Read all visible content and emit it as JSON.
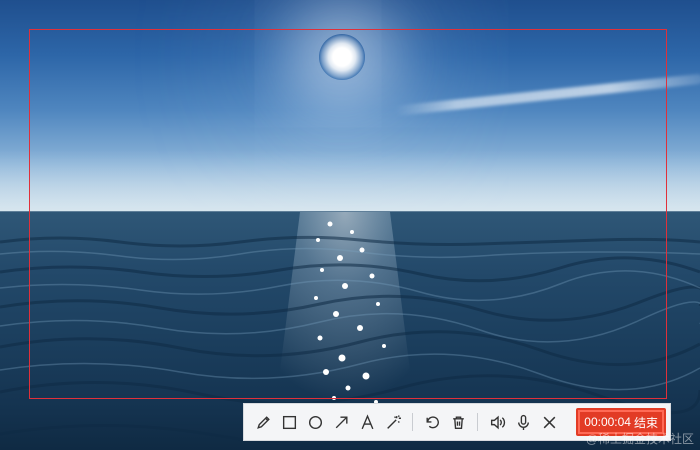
{
  "scene": {
    "description_icon": "ocean-sunset-photo"
  },
  "selection": {
    "color": "#e0303a"
  },
  "toolbar": {
    "tools": [
      {
        "name": "pencil-icon"
      },
      {
        "name": "rectangle-icon"
      },
      {
        "name": "ellipse-icon"
      },
      {
        "name": "arrow-icon"
      },
      {
        "name": "text-icon"
      },
      {
        "name": "magic-wand-icon"
      },
      {
        "name": "undo-icon"
      },
      {
        "name": "trash-icon"
      },
      {
        "name": "speaker-icon"
      },
      {
        "name": "microphone-icon"
      },
      {
        "name": "close-icon"
      }
    ],
    "timer": "00:00:04",
    "end_label": "结束",
    "end_color": "#e23b25"
  },
  "watermark": "@稀土掘金技术社区"
}
